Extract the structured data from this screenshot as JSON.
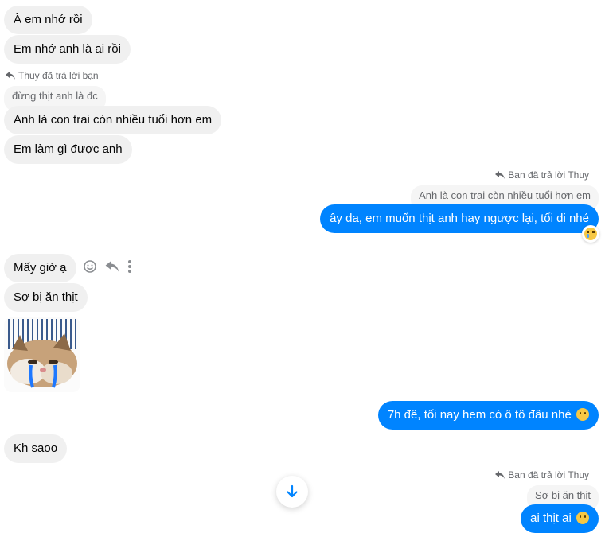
{
  "messages_in_top": [
    "À em nhớ rồi",
    "Em nhớ anh là ai rồi"
  ],
  "reply1": {
    "meta": "Thuy đã trả lời bạn",
    "quote": "đừng thịt anh là đc",
    "messages": [
      "Anh là con trai còn nhiều tuổi hơn em",
      "Em làm gì được anh"
    ]
  },
  "reply2": {
    "meta": "Bạn đã trả lời Thuy",
    "quote": "Anh là con trai còn nhiều tuổi hơn em",
    "message": "ây da, em muốn thịt anh hay ngược lại, tối di nhé",
    "reaction": "sad-face-icon"
  },
  "messages_in_mid": [
    "Mấy giờ ạ",
    "Sợ bị ăn thịt"
  ],
  "sticker": {
    "name": "crying-cat-sticker"
  },
  "out_mid": {
    "message": "7h đê, tối nay hem có ô tô đâu nhé"
  },
  "in_bottom": {
    "message": "Kh saoo"
  },
  "reply3": {
    "meta": "Bạn đã trả lời Thuy",
    "quote": "Sợ bị ăn thịt",
    "message": "ai thịt ai"
  },
  "colors": {
    "outgoing": "#0084ff",
    "incoming": "#f0f0f0",
    "meta": "#65676b"
  }
}
